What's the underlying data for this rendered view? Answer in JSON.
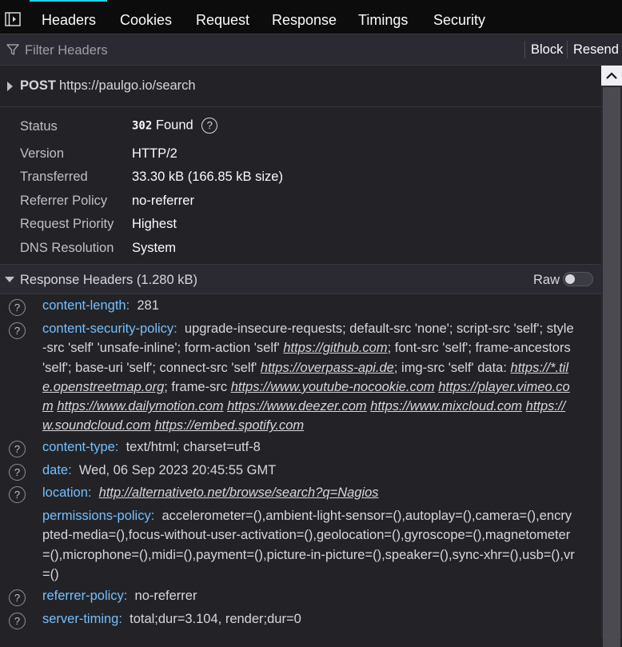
{
  "tabs": [
    "Headers",
    "Cookies",
    "Request",
    "Response",
    "Timings",
    "Security"
  ],
  "filter": {
    "placeholder": "Filter Headers"
  },
  "toolbar": {
    "block_label": "Block",
    "resend_label": "Resend"
  },
  "request": {
    "method": "POST",
    "url": "https://paulgo.io/search"
  },
  "summary": {
    "status_label": "Status",
    "status_code": "302",
    "status_text": "Found",
    "help": "?",
    "version_label": "Version",
    "version": "HTTP/2",
    "transferred_label": "Transferred",
    "transferred": "33.30 kB (166.85 kB size)",
    "referrer_label": "Referrer Policy",
    "referrer": "no-referrer",
    "priority_label": "Request Priority",
    "priority": "Highest",
    "dns_label": "DNS Resolution",
    "dns": "System"
  },
  "response_headers": {
    "title": "Response Headers (1.280 kB)",
    "raw_label": "Raw",
    "raw_enabled": false,
    "help": "?",
    "items": [
      {
        "name": "content-length:",
        "value": "281"
      },
      {
        "name": "content-security-policy:",
        "segments": [
          {
            "t": "upgrade-insecure-requests; default-src 'none'; script-src 'self'; style-src 'self' 'unsafe-inline'; form-action 'self' ",
            "link": false
          },
          {
            "t": "https://github.com",
            "link": true
          },
          {
            "t": "; font-src 'self'; frame-ancestors 'self'; base-uri 'self'; connect-src 'self' ",
            "link": false
          },
          {
            "t": "https://overpass-api.de",
            "link": true
          },
          {
            "t": "; img-src 'self' data: ",
            "link": false
          },
          {
            "t": "https://*.tile.openstreetmap.org",
            "link": true
          },
          {
            "t": "; frame-src ",
            "link": false
          },
          {
            "t": "https://www.youtube-nocookie.com",
            "link": true
          },
          {
            "t": " ",
            "link": false
          },
          {
            "t": "https://player.vimeo.com",
            "link": true
          },
          {
            "t": " ",
            "link": false
          },
          {
            "t": "https://www.dailymotion.com",
            "link": true
          },
          {
            "t": " ",
            "link": false
          },
          {
            "t": "https://www.deezer.com",
            "link": true
          },
          {
            "t": " ",
            "link": false
          },
          {
            "t": "https://www.mixcloud.com",
            "link": true
          },
          {
            "t": " ",
            "link": false
          },
          {
            "t": "https://w.soundcloud.com",
            "link": true
          },
          {
            "t": " ",
            "link": false
          },
          {
            "t": "https://embed.spotify.com",
            "link": true
          }
        ]
      },
      {
        "name": "content-type:",
        "value": "text/html; charset=utf-8"
      },
      {
        "name": "date:",
        "value": "Wed, 06 Sep 2023 20:45:55 GMT"
      },
      {
        "name": "location:",
        "link": "http://alternativeto.net/browse/search?q=Nagios"
      },
      {
        "name": "permissions-policy:",
        "value": "accelerometer=(),ambient-light-sensor=(),autoplay=(),camera=(),encrypted-media=(),focus-without-user-activation=(),geolocation=(),gyroscope=(),magnetometer=(),microphone=(),midi=(),payment=(),picture-in-picture=(),speaker=(),sync-xhr=(),usb=(),vr=()"
      },
      {
        "name": "referrer-policy:",
        "value": "no-referrer"
      },
      {
        "name": "server-timing:",
        "value": "total;dur=3.104, render;dur=0"
      }
    ]
  },
  "colors": {
    "accent": "#00ddff",
    "header_name": "#75bfff",
    "background": "#232327"
  }
}
